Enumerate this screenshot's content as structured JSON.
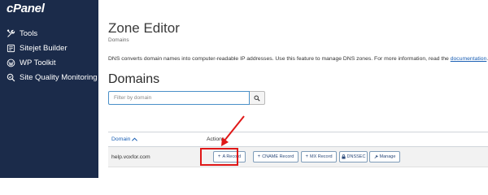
{
  "sidebar": {
    "logo": "cPanel",
    "items": [
      {
        "label": "Tools",
        "icon": "tools-icon"
      },
      {
        "label": "Sitejet Builder",
        "icon": "sitejet-icon"
      },
      {
        "label": "WP Toolkit",
        "icon": "wordpress-icon"
      },
      {
        "label": "Site Quality Monitoring",
        "icon": "site-quality-icon"
      }
    ]
  },
  "main": {
    "title": "Zone Editor",
    "breadcrumb": "Domains",
    "description": "DNS converts domain names into computer-readable IP addresses. Use this feature to manage DNS zones. For more information, read the ",
    "doc_link": "documentation",
    "description_end": ".",
    "section_title": "Domains",
    "search": {
      "placeholder": "Filter by domain",
      "icon": "search-icon"
    },
    "table": {
      "columns": [
        "Domain",
        "Actions"
      ],
      "sort_icon": "sort-ascending-icon",
      "rows": [
        {
          "domain": "help.voxfor.com",
          "actions": [
            {
              "label": "A Record",
              "icon": "plus-icon"
            },
            {
              "label": "CNAME Record",
              "icon": "plus-icon"
            },
            {
              "label": "MX Record",
              "icon": "plus-icon"
            },
            {
              "label": "DNSSEC",
              "icon": "lock-icon"
            },
            {
              "label": "Manage",
              "icon": "wrench-icon"
            }
          ]
        }
      ]
    }
  },
  "annotation": {
    "highlight_color": "#e01818",
    "target": "A Record"
  },
  "colors": {
    "sidebar_bg": "#1b2b4a",
    "accent": "#1a5fb4",
    "button_border": "#7f9db9"
  }
}
